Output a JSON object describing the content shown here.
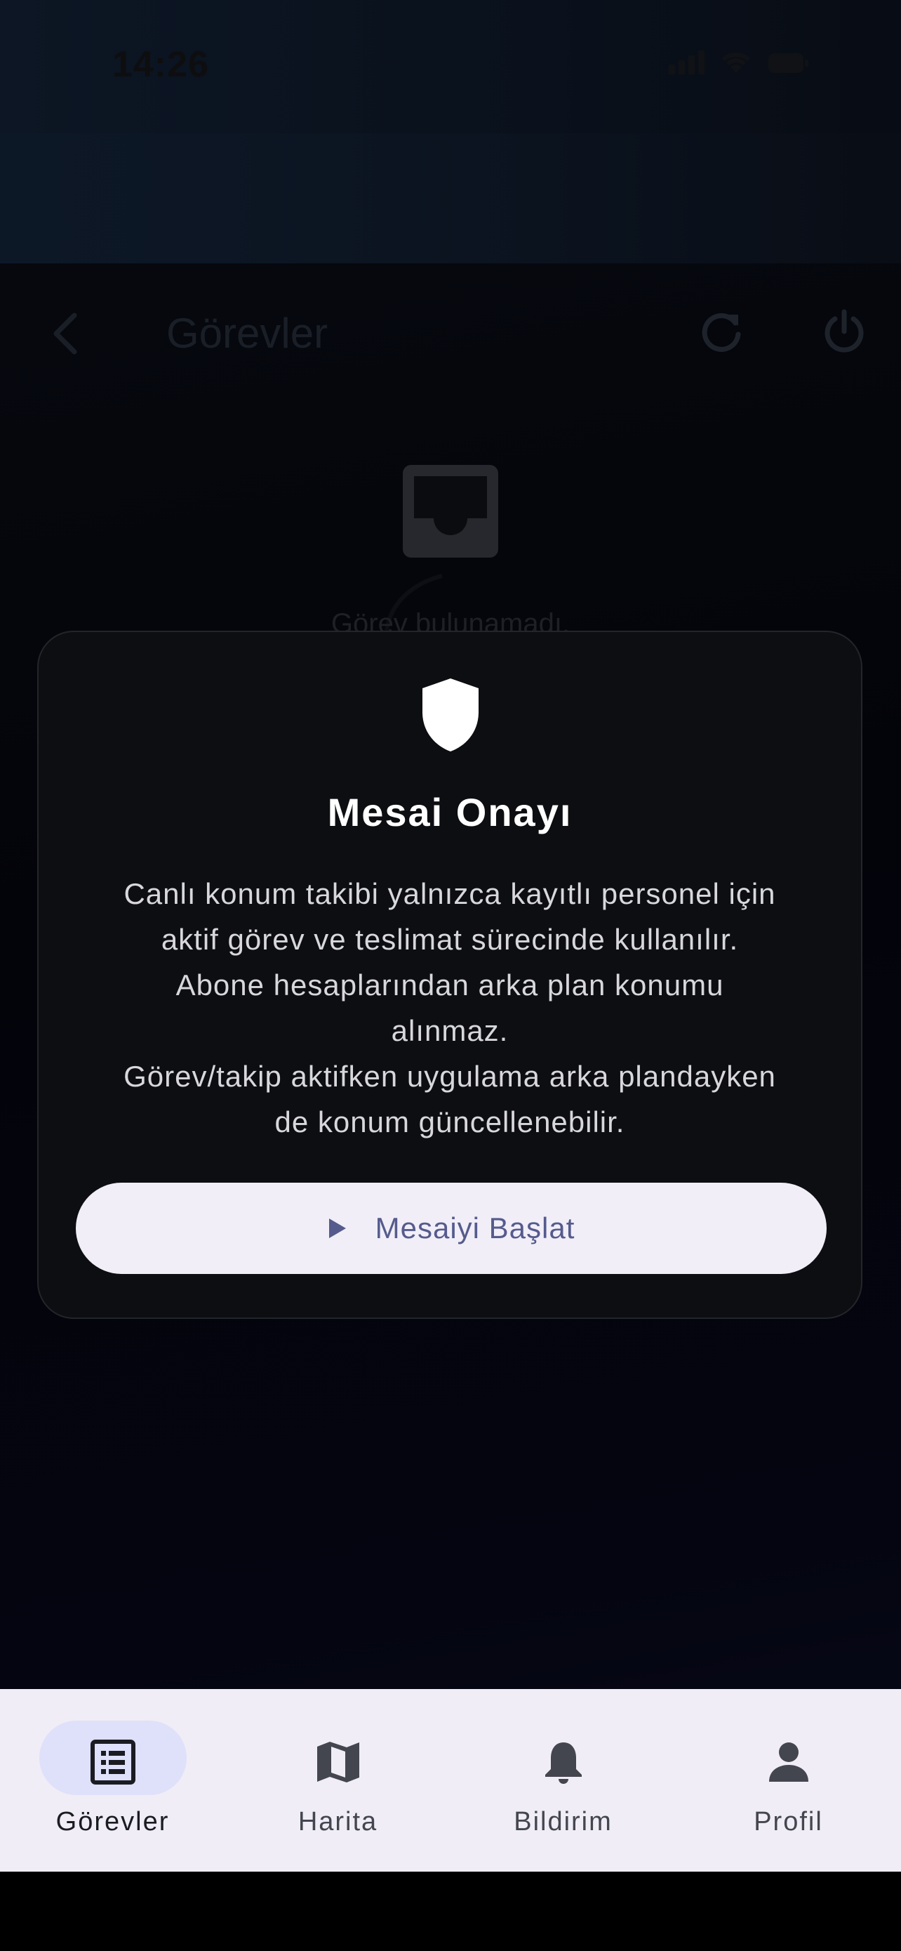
{
  "status_bar": {
    "time": "14:26"
  },
  "header": {
    "title": "Görevler"
  },
  "empty_state": {
    "message": "Görev bulunamadı."
  },
  "dialog": {
    "title": "Mesai Onayı",
    "body_lines": [
      "Canlı konum takibi yalnızca kayıtlı personel için",
      "aktif görev ve teslimat sürecinde kullanılır.",
      "Abone hesaplarından arka plan konumu",
      "alınmaz.",
      "Görev/takip aktifken uygulama arka plandayken",
      "de konum güncellenebilir."
    ],
    "button_label": "Mesaiyi Başlat",
    "button_icon": "play-icon"
  },
  "bottom_nav": {
    "items": [
      {
        "label": "Görevler",
        "icon": "list-icon",
        "active": true
      },
      {
        "label": "Harita",
        "icon": "map-icon",
        "active": false
      },
      {
        "label": "Bildirim",
        "icon": "bell-icon",
        "active": false
      },
      {
        "label": "Profil",
        "icon": "person-icon",
        "active": false
      }
    ]
  },
  "colors": {
    "dialog_bg": "#0d0e11",
    "button_bg": "#f1eef8",
    "button_text": "#555b8c",
    "nav_bg": "#f0edf6",
    "nav_active_pill": "#dfe0fa"
  }
}
